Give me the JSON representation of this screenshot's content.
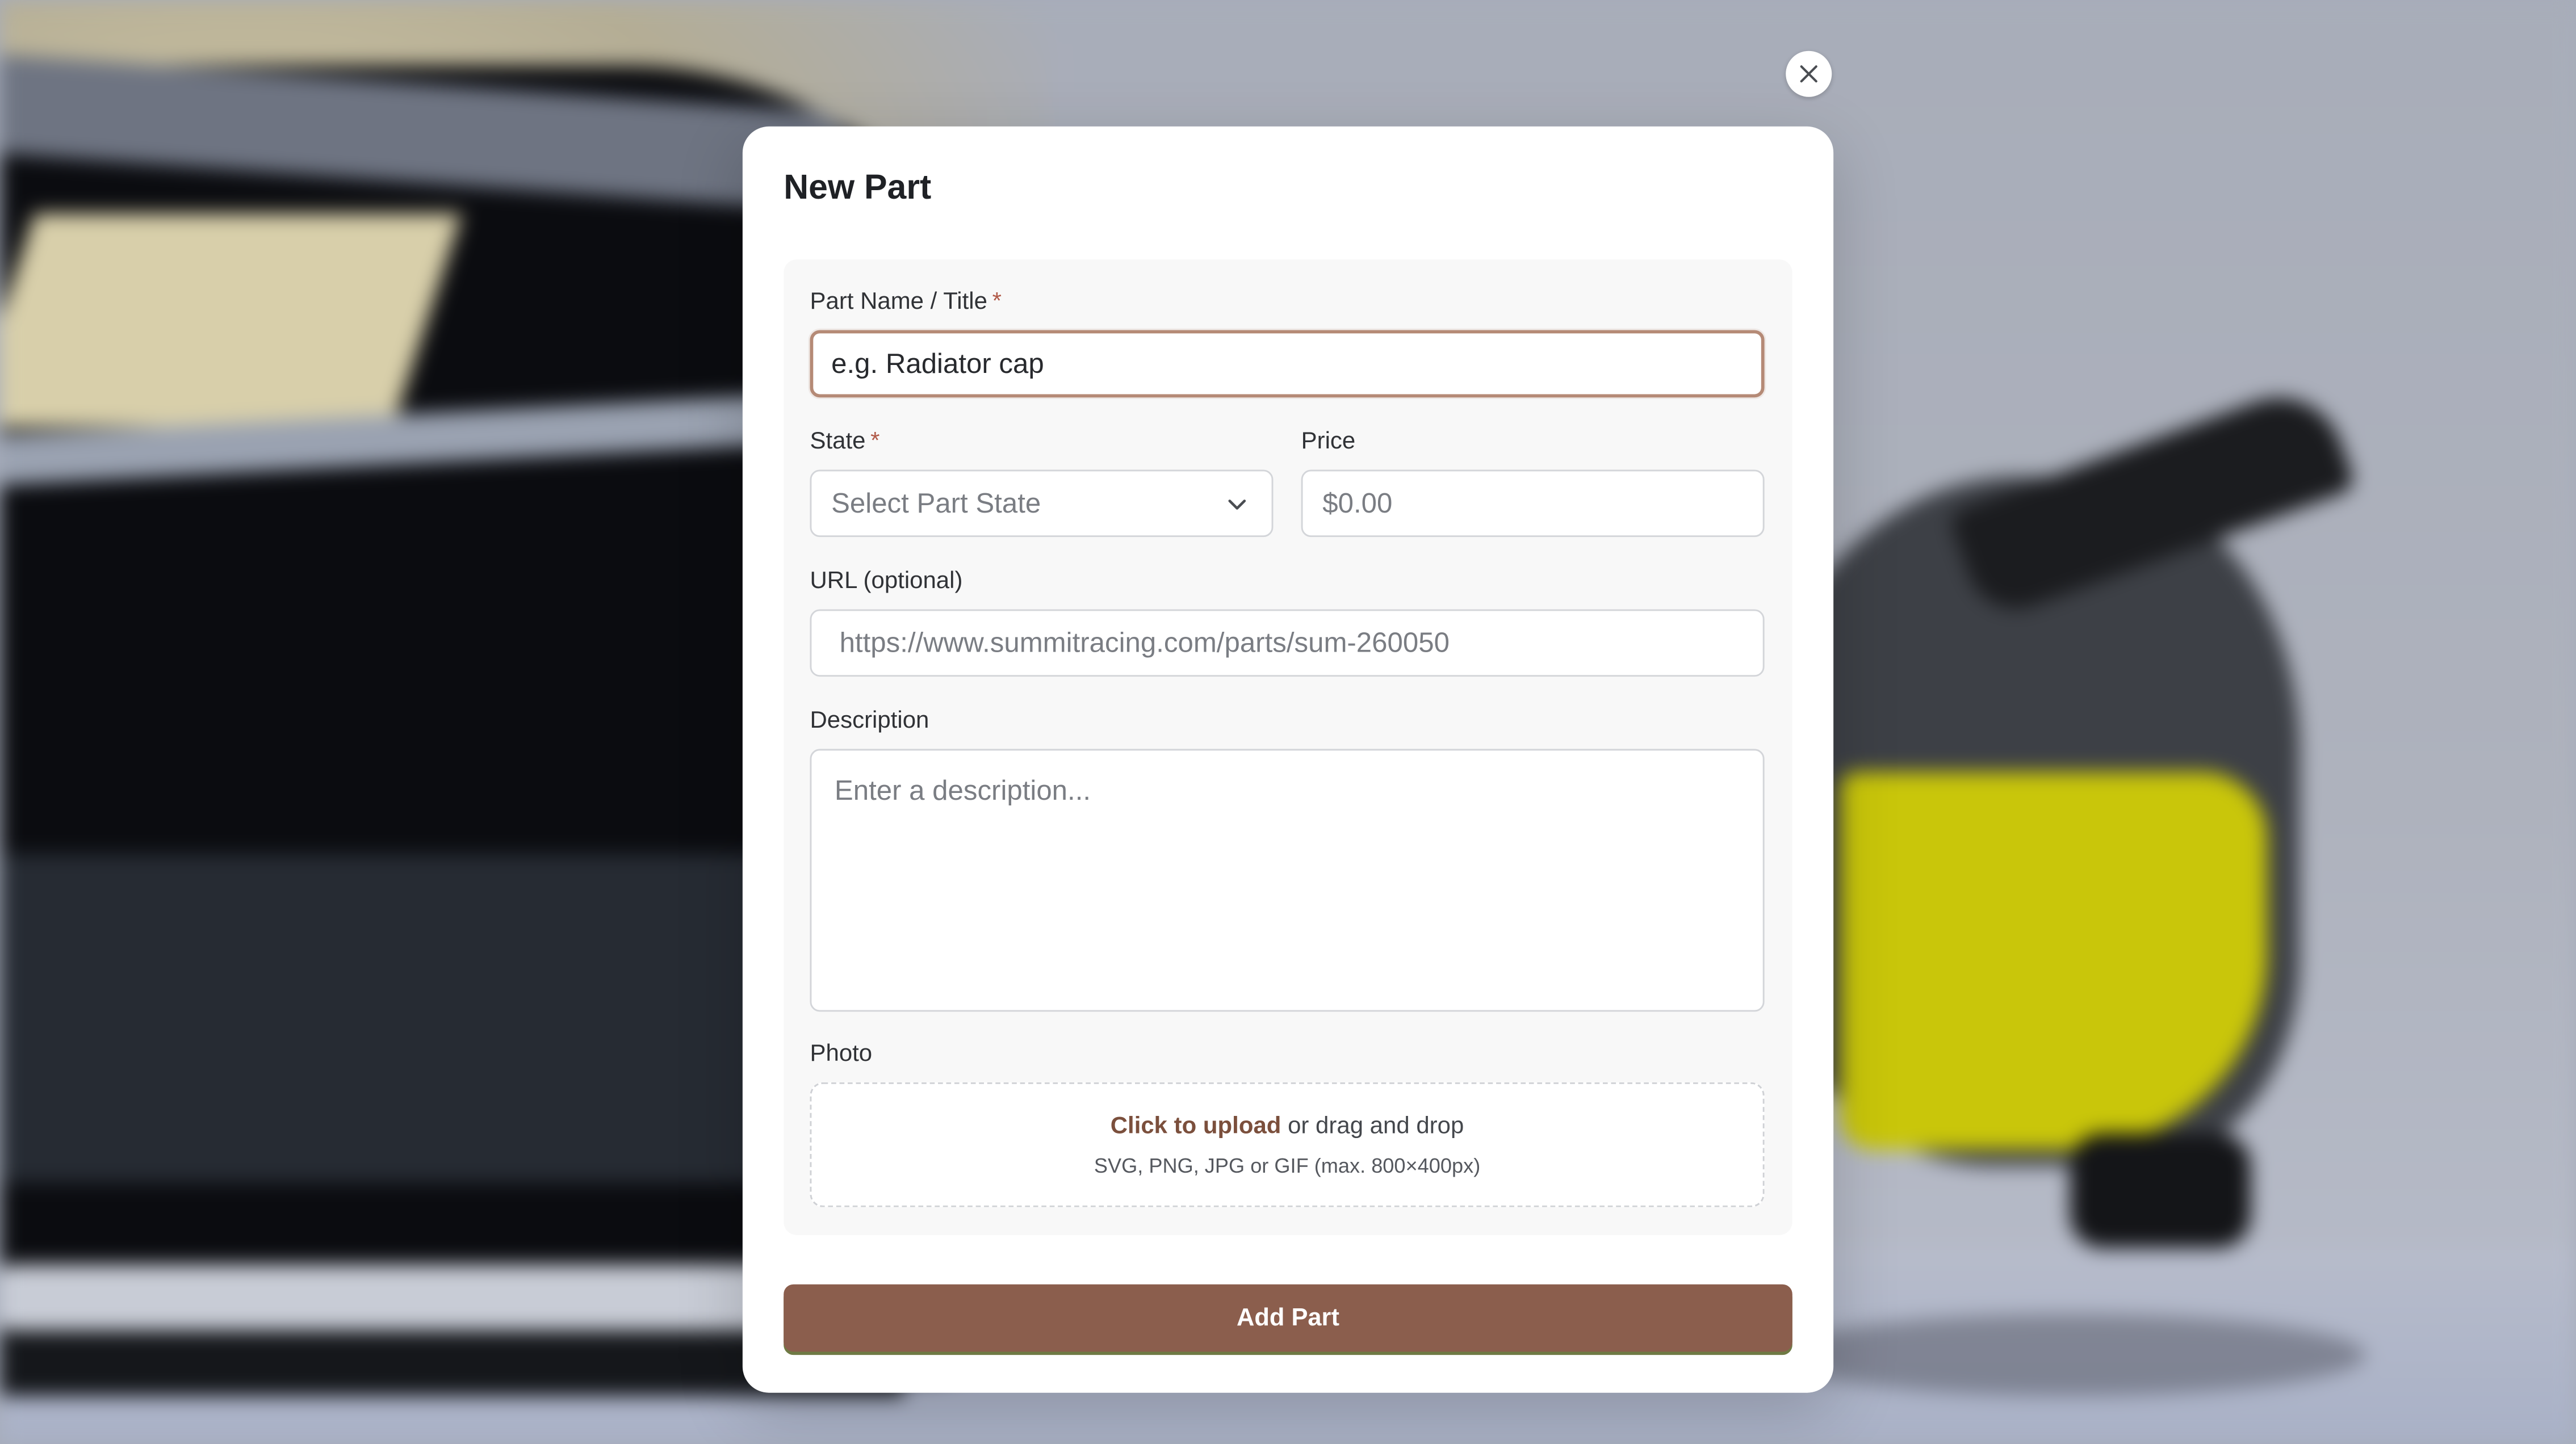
{
  "colors": {
    "accent": "#8b5e4d",
    "link": "#7b4f3c",
    "required": "#b15a49",
    "focus_border": "#b58a76"
  },
  "modal": {
    "title": "New Part",
    "close_icon": "close-icon"
  },
  "form": {
    "part_name": {
      "label": "Part Name / Title",
      "required_mark": "*",
      "placeholder": "e.g. Radiator cap"
    },
    "state": {
      "label": "State",
      "required_mark": "*",
      "placeholder": "Select Part State",
      "icon": "chevron-down-icon"
    },
    "price": {
      "label": "Price",
      "placeholder": "$0.00"
    },
    "url": {
      "label": "URL (optional)",
      "placeholder": "https://www.summitracing.com/parts/sum-260050"
    },
    "description": {
      "label": "Description",
      "placeholder": "Enter a description..."
    },
    "photo": {
      "label": "Photo",
      "upload_link": "Click to upload",
      "upload_text": " or drag and drop",
      "hint": "SVG, PNG, JPG or GIF (max. 800×400px)"
    }
  },
  "actions": {
    "submit_label": "Add Part"
  }
}
